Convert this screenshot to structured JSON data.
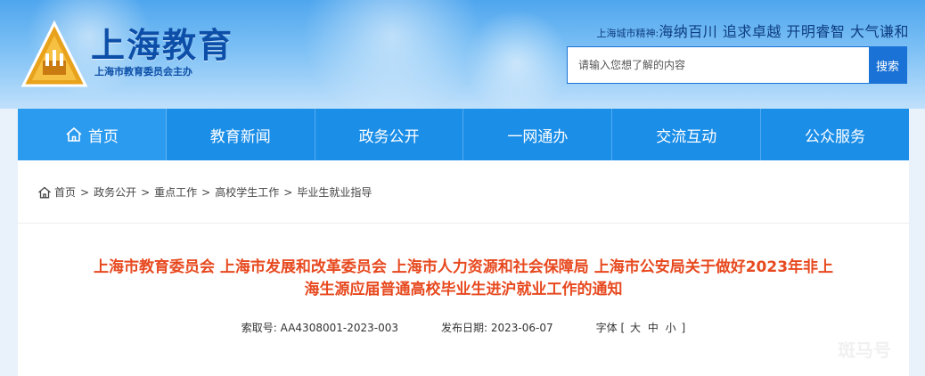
{
  "header": {
    "site_title": "上海教育",
    "site_subtitle": "上海市教育委员会主办",
    "spirit_lead": "上海城市精神:",
    "spirit_motto": "海纳百川 追求卓越 开明睿智 大气谦和",
    "search_placeholder": "请输入您想了解的内容",
    "search_button": "搜索"
  },
  "nav": {
    "items": [
      {
        "label": "首页"
      },
      {
        "label": "教育新闻"
      },
      {
        "label": "政务公开"
      },
      {
        "label": "一网通办"
      },
      {
        "label": "交流互动"
      },
      {
        "label": "公众服务"
      }
    ]
  },
  "breadcrumb": {
    "items": [
      "首页",
      "政务公开",
      "重点工作",
      "高校学生工作",
      "毕业生就业指导"
    ],
    "separator": ">"
  },
  "article": {
    "title_line1": "上海市教育委员会 上海市发展和改革委员会 上海市人力资源和社会保障局 上海市公安局关于做好2023年非上",
    "title_line2": "海生源应届普通高校毕业生进沪就业工作的通知",
    "index_label": "索取号:",
    "index_value": "AA4308001-2023-003",
    "date_label": "发布日期:",
    "date_value": "2023-06-07",
    "font_label": "字体",
    "font_open": "[",
    "font_large": "大",
    "font_medium": "中",
    "font_small": "小",
    "font_close": "]"
  },
  "watermark": "斑马号",
  "colors": {
    "nav_bg": "#1b8ee8",
    "title_red": "#e7491f",
    "brand_blue": "#0d4fa8",
    "search_btn": "#1a72d6"
  }
}
